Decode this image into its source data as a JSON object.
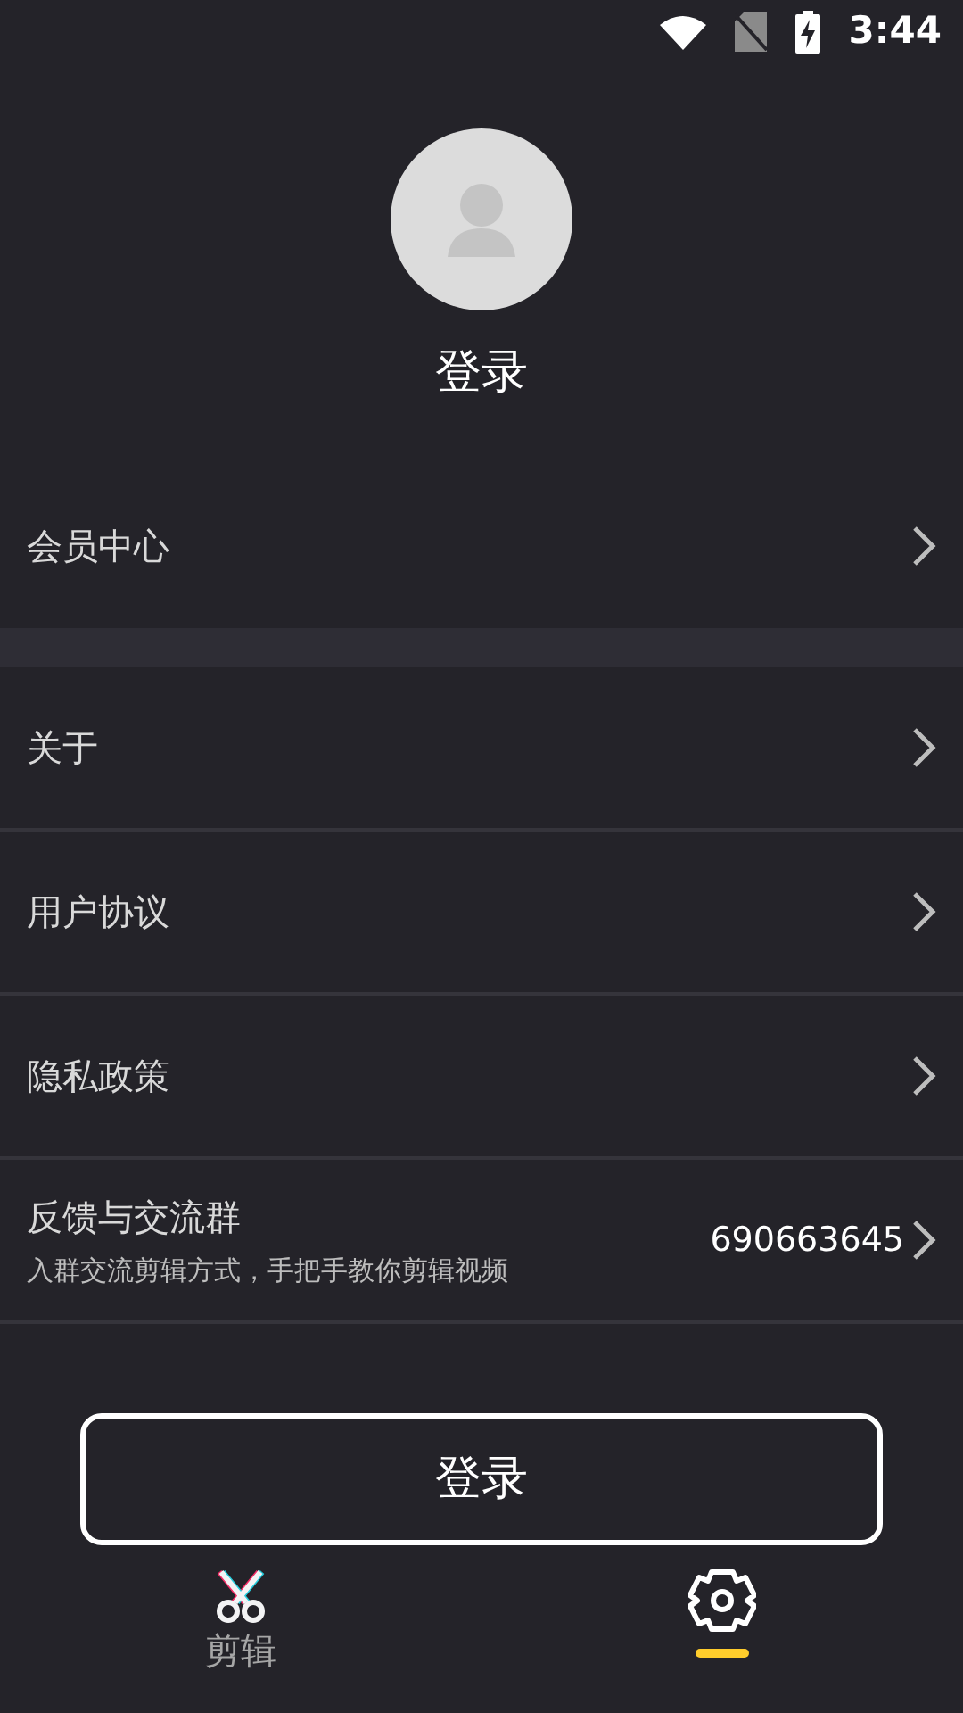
{
  "status_bar": {
    "time": "3:44"
  },
  "profile": {
    "name": "登录"
  },
  "sections": [
    {
      "items": [
        {
          "kind": "simple",
          "label": "会员中心"
        }
      ]
    },
    {
      "items": [
        {
          "kind": "simple",
          "label": "关于"
        },
        {
          "kind": "simple",
          "label": "用户协议"
        },
        {
          "kind": "simple",
          "label": "隐私政策"
        },
        {
          "kind": "detail",
          "label": "反馈与交流群",
          "subtitle": "入群交流剪辑方式，手把手教你剪辑视频",
          "value": "690663645"
        }
      ]
    }
  ],
  "login_button": "登录",
  "tabs": [
    {
      "kind": "scissors",
      "label": "剪辑",
      "selected": false
    },
    {
      "kind": "gear",
      "selected": true
    }
  ]
}
